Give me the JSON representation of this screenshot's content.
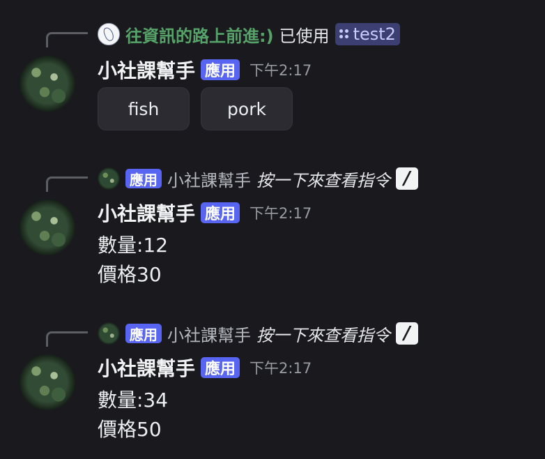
{
  "messages": [
    {
      "reply": {
        "user_name": "往資訊的路上前進:)",
        "action": "已使用",
        "channel": "test2"
      },
      "author": "小社課幫手",
      "app_tag": "應用",
      "time": "下午2:17",
      "buttons": [
        "fish",
        "pork"
      ]
    },
    {
      "reply": {
        "app_tag": "應用",
        "bot_name": "小社課幫手",
        "hint": "按一下來查看指令"
      },
      "author": "小社課幫手",
      "app_tag": "應用",
      "time": "下午2:17",
      "lines": [
        "數量:12",
        "價格30"
      ]
    },
    {
      "reply": {
        "app_tag": "應用",
        "bot_name": "小社課幫手",
        "hint": "按一下來查看指令"
      },
      "author": "小社課幫手",
      "app_tag": "應用",
      "time": "下午2:17",
      "lines": [
        "數量:34",
        "價格50"
      ]
    }
  ],
  "colors": {
    "background": "#1a1a1e",
    "app_tag": "#5865f2",
    "reply_user": "#56a36a",
    "channel_chip": "#3b3f71"
  }
}
